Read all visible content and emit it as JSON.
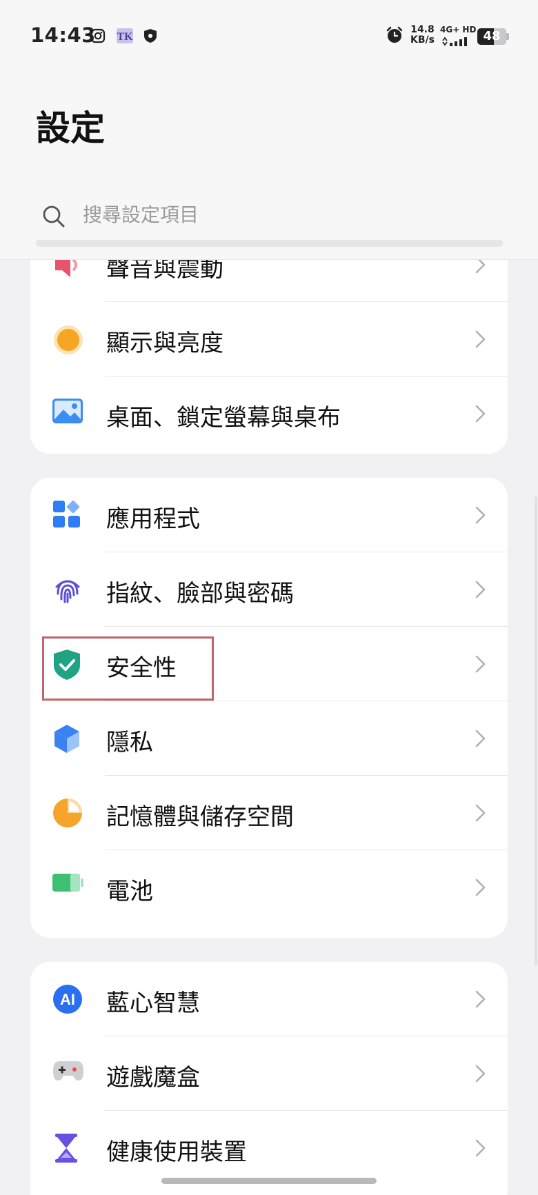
{
  "status_bar": {
    "time": "14:43",
    "speed_value": "14.8",
    "speed_unit": "KB/s",
    "network": "4G+ HD",
    "battery": "48",
    "icons": [
      "instagram-icon",
      "app-notification-icon",
      "shield-icon",
      "alarm-icon",
      "signal-icon"
    ]
  },
  "header": {
    "title": "設定",
    "search_placeholder": "搜尋設定項目"
  },
  "groups": [
    {
      "items": [
        {
          "label": "聲音與震動",
          "icon": "sound-icon",
          "color": "#e9536b"
        },
        {
          "label": "顯示與亮度",
          "icon": "brightness-icon",
          "color": "#f5a623"
        },
        {
          "label": "桌面、鎖定螢幕與桌布",
          "icon": "wallpaper-icon",
          "color": "#3a8ef0"
        }
      ]
    },
    {
      "items": [
        {
          "label": "應用程式",
          "icon": "apps-icon",
          "color": "#2f7df6"
        },
        {
          "label": "指紋、臉部與密碼",
          "icon": "fingerprint-icon",
          "color": "#5b4fd6"
        },
        {
          "label": "安全性",
          "icon": "security-shield-icon",
          "color": "#1fa383"
        },
        {
          "label": "隱私",
          "icon": "privacy-cube-icon",
          "color": "#3b82f0"
        },
        {
          "label": "記憶體與儲存空間",
          "icon": "storage-pie-icon",
          "color": "#f6a52a"
        },
        {
          "label": "電池",
          "icon": "battery-icon",
          "color": "#3fbf74"
        }
      ]
    },
    {
      "items": [
        {
          "label": "藍心智慧",
          "icon": "ai-icon",
          "color": "#2a6ff0"
        },
        {
          "label": "遊戲魔盒",
          "icon": "gamepad-icon",
          "color": "#9a9aa0"
        },
        {
          "label": "健康使用裝置",
          "icon": "hourglass-icon",
          "color": "#6b4fe0"
        }
      ]
    }
  ]
}
